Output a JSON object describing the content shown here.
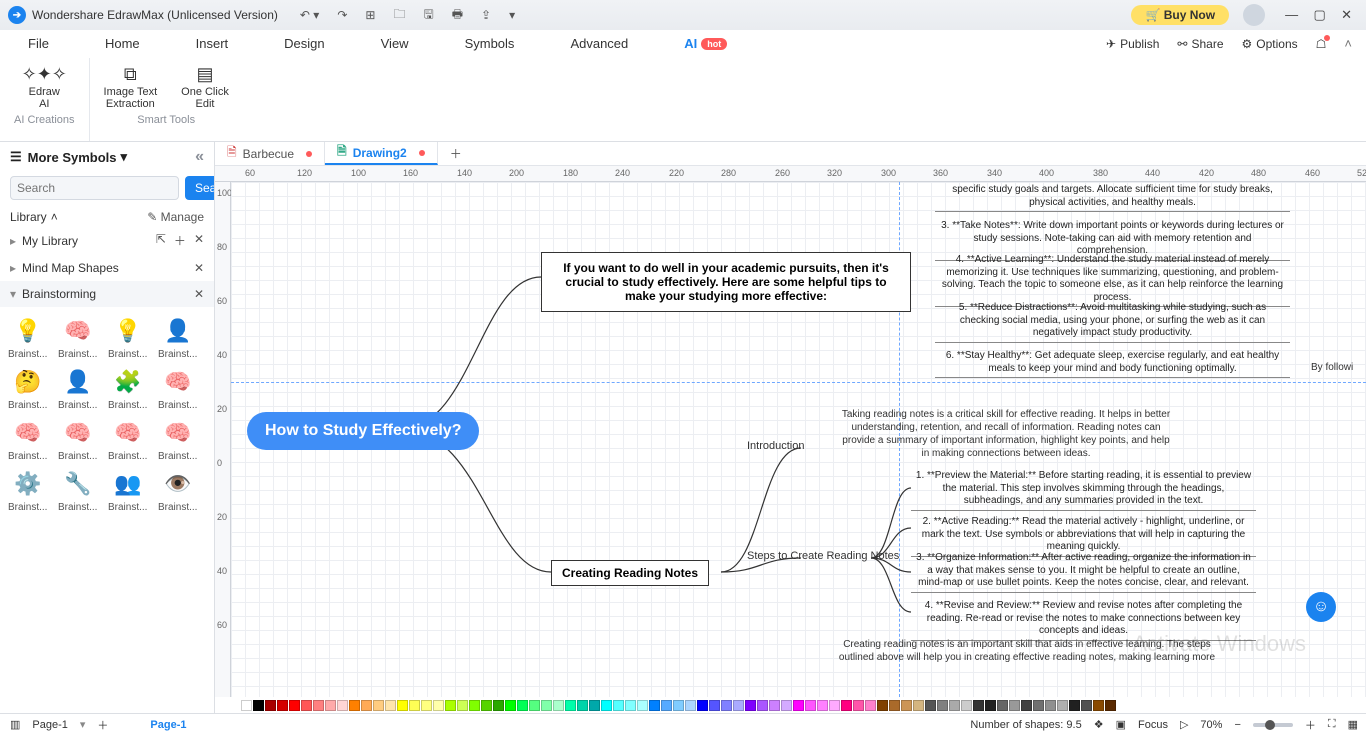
{
  "title": "Wondershare EdrawMax (Unlicensed Version)",
  "buy": "Buy Now",
  "menus": {
    "file": "File",
    "home": "Home",
    "insert": "Insert",
    "design": "Design",
    "view": "View",
    "symbols": "Symbols",
    "advanced": "Advanced",
    "ai": "AI",
    "hot": "hot",
    "publish": "Publish",
    "share": "Share",
    "options": "Options"
  },
  "tools": {
    "ai": "Edraw\nAI",
    "extract": "Image Text\nExtraction",
    "oneclick": "One Click\nEdit",
    "g1": "AI Creations",
    "g2": "Smart Tools"
  },
  "side": {
    "more": "More Symbols",
    "search_ph": "Search",
    "search_btn": "Search",
    "library": "Library",
    "manage": "Manage",
    "mylib": "My Library",
    "mindmap": "Mind Map Shapes",
    "brain": "Brainstorming",
    "cell": "Brainst..."
  },
  "tabs": {
    "t1": "Barbecue",
    "t2": "Drawing2"
  },
  "ruler_h": [
    "60",
    "100",
    "140",
    "180",
    "220",
    "260",
    "300",
    "340",
    "380",
    "420",
    "460"
  ],
  "ruler_top": [
    "120",
    "160",
    "200",
    "240",
    "280",
    "320",
    "360",
    "400",
    "440",
    "480",
    "520"
  ],
  "ruler_v": [
    "100",
    "80",
    "60",
    "40",
    "20",
    "0",
    "20",
    "40",
    "60"
  ],
  "mind": {
    "root": "How to Study Effectively?",
    "intro": "If you want to do well in your academic pursuits, then it's crucial to study effectively. Here are some helpful tips to make your studying more effective:",
    "creating": "Creating Reading Notes",
    "introduction": "Introduction",
    "steps": "Steps to Create Reading Notes",
    "tip_item1": "specific study goals and targets. Allocate sufficient time for study breaks, physical activities, and healthy meals.",
    "tip_item3": "3. **Take Notes**: Write down important points or keywords during lectures or study sessions. Note-taking can aid with memory retention and comprehension.",
    "tip_item4": "4. **Active Learning**: Understand the study material instead of merely memorizing it. Use techniques like summarizing, questioning, and problem-solving. Teach the topic to someone else, as it can help reinforce the learning process.",
    "tip_item5": "5. **Reduce Distractions**: Avoid multitasking while studying, such as checking social media, using your phone, or surfing the web as it can negatively impact study productivity.",
    "tip_item6": "6. **Stay Healthy**: Get adequate sleep, exercise regularly, and eat healthy meals to keep your mind and body functioning optimally.",
    "byfollow": "By followi",
    "intro_para": "Taking reading notes is a critical skill for effective reading. It helps in better understanding, retention, and recall of information. Reading notes can provide a summary of important information, highlight key points, and help in making connections between ideas.",
    "step1": "1. **Preview the Material:** Before starting reading, it is essential to preview the material. This step involves skimming through the headings, subheadings, and any summaries provided in the text.",
    "step2": "2. **Active Reading:** Read the material actively - highlight, underline, or mark the text. Use symbols or abbreviations that will help in capturing the meaning quickly.",
    "step3": "3. **Organize Information:** After active reading, organize the information in a way that makes sense to you. It might be helpful to create an outline, mind-map or use bullet points. Keep the notes concise, clear, and relevant.",
    "step4": "4. **Revise and Review:** Review and revise notes after completing the reading. Re-read or revise the notes to make connections between key concepts and ideas.",
    "conclusion": "Creating reading notes is an important skill that aids in effective learning. The steps outlined above will help you in creating effective reading notes, making learning more"
  },
  "status": {
    "page": "Page-1",
    "shapes": "Number of shapes: 9.5",
    "focus": "Focus",
    "zoom": "70%"
  },
  "watermark": "Activate Windows",
  "colors": [
    "#ffffff",
    "#000000",
    "#a80000",
    "#d40000",
    "#ff0000",
    "#ff5555",
    "#ff8080",
    "#ffaaaa",
    "#ffd5d5",
    "#ff8000",
    "#ffaa55",
    "#ffcc80",
    "#ffe5aa",
    "#ffff00",
    "#ffff55",
    "#ffff80",
    "#ffffaa",
    "#aaff00",
    "#ccff55",
    "#80ff00",
    "#55d400",
    "#2aa800",
    "#00ff00",
    "#00ff55",
    "#55ff80",
    "#80ffaa",
    "#aaffcc",
    "#00ffaa",
    "#00d4aa",
    "#00a8aa",
    "#00ffff",
    "#55ffff",
    "#80ffff",
    "#aaffff",
    "#0080ff",
    "#55aaff",
    "#80ccff",
    "#aad4ff",
    "#0000ff",
    "#5555ff",
    "#8080ff",
    "#aaaaff",
    "#8000ff",
    "#aa55ff",
    "#cc80ff",
    "#d4aaff",
    "#ff00ff",
    "#ff55ff",
    "#ff80ff",
    "#ffaaff",
    "#ff0080",
    "#ff55aa",
    "#ff80cc",
    "#804000",
    "#aa6a2a",
    "#cc9555",
    "#d4b580",
    "#555555",
    "#808080",
    "#aaaaaa",
    "#cccccc",
    "#333333",
    "#222222",
    "#666666",
    "#999999",
    "#404040",
    "#707070",
    "#909090",
    "#b0b0b0",
    "#202020",
    "#505050",
    "#8a4a00",
    "#5a2a00"
  ]
}
